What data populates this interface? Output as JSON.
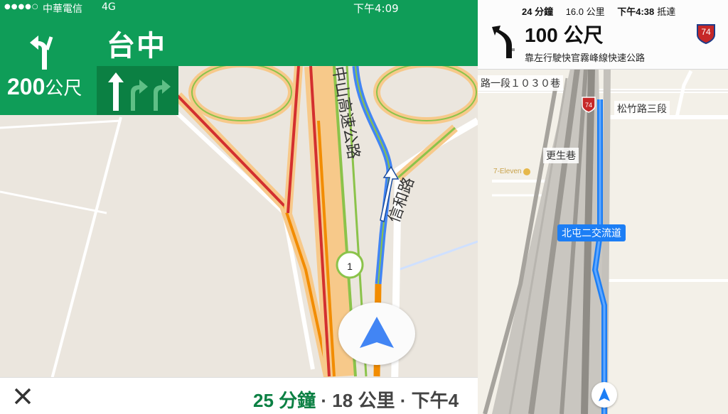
{
  "left": {
    "status_bar": {
      "signal": "●●●●○",
      "carrier": "中華電信",
      "network": "4G",
      "time": "下午4:09"
    },
    "guidance": {
      "destination": "台中",
      "distance_value": "200",
      "distance_unit": "公尺"
    },
    "map_labels": {
      "highway": "中山高速公路",
      "road": "信和路",
      "shield_number": "1"
    },
    "bottom": {
      "eta": "25 分鐘",
      "separator": "·",
      "distance": "18 公里",
      "arrival": "下午4"
    },
    "colors": {
      "banner": "#0f9d58",
      "lane_bg": "#0b8043",
      "eta": "#0b8043",
      "route": "#4285f4"
    },
    "icons": [
      "turn-left-icon",
      "lane-straight-icon",
      "lane-right-icon",
      "close-icon",
      "navigation-arrow-icon"
    ]
  },
  "right": {
    "summary": {
      "duration": "24 分鐘",
      "distance": "16.0 公里",
      "arrival": "下午4:38",
      "arrival_label": "抵達"
    },
    "guidance": {
      "distance": "100 公尺",
      "instruction": "靠左行駛快官霧峰線快速公路",
      "shield": "74"
    },
    "map_labels": {
      "lane": "路一段１０３０巷",
      "road1": "松竹路三段",
      "road2": "更生巷",
      "poi": "7-Eleven",
      "exit": "北屯二交流道",
      "shield": "74"
    },
    "colors": {
      "route": "#1c7ef5",
      "exit_bg": "#1c7ef5"
    }
  }
}
